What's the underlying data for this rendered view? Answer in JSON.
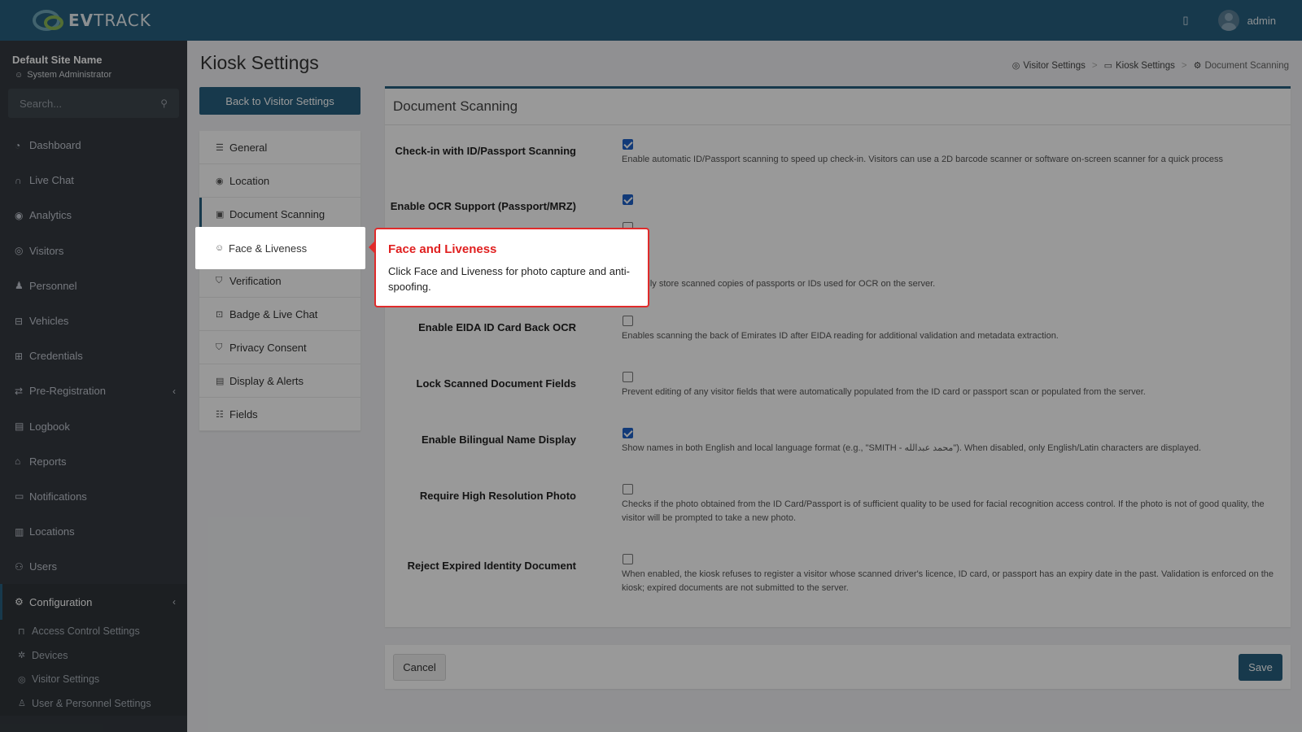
{
  "topbar": {
    "brand": "EVTRACK",
    "brand_bold": "EV",
    "brand_rest": "TRACK",
    "user": "admin"
  },
  "sidebar": {
    "site_name": "Default Site Name",
    "role": "System Administrator",
    "search_placeholder": "Search...",
    "items": [
      {
        "label": "Dashboard",
        "icon": "dashboard-icon"
      },
      {
        "label": "Live Chat",
        "icon": "headset-icon"
      },
      {
        "label": "Analytics",
        "icon": "analytics-icon"
      },
      {
        "label": "Visitors",
        "icon": "eye-icon"
      },
      {
        "label": "Personnel",
        "icon": "personnel-icon"
      },
      {
        "label": "Vehicles",
        "icon": "car-icon"
      },
      {
        "label": "Credentials",
        "icon": "credentials-icon"
      },
      {
        "label": "Pre-Registration",
        "icon": "pre-registration-icon"
      },
      {
        "label": "Logbook",
        "icon": "logbook-icon"
      },
      {
        "label": "Reports",
        "icon": "reports-icon"
      },
      {
        "label": "Notifications",
        "icon": "notifications-icon"
      },
      {
        "label": "Locations",
        "icon": "map-icon"
      },
      {
        "label": "Users",
        "icon": "users-icon"
      },
      {
        "label": "Configuration",
        "icon": "gear-icon"
      }
    ],
    "sub_items": [
      {
        "label": "Access Control Settings",
        "icon": "lock-icon"
      },
      {
        "label": "Devices",
        "icon": "devices-icon"
      },
      {
        "label": "Visitor Settings",
        "icon": "eye-icon"
      },
      {
        "label": "User & Personnel Settings",
        "icon": "user-settings-icon"
      }
    ]
  },
  "page": {
    "title": "Kiosk Settings",
    "breadcrumb": [
      "Visitor Settings",
      "Kiosk Settings",
      "Document Scanning"
    ],
    "back_button": "Back to Visitor Settings"
  },
  "settings_menu": [
    {
      "label": "General",
      "icon": "sliders-icon"
    },
    {
      "label": "Location",
      "icon": "pin-icon"
    },
    {
      "label": "Document Scanning",
      "icon": "scan-icon"
    },
    {
      "label": "Face & Liveness",
      "icon": "face-icon"
    },
    {
      "label": "Verification",
      "icon": "shield-check-icon"
    },
    {
      "label": "Badge & Live Chat",
      "icon": "badge-icon"
    },
    {
      "label": "Privacy Consent",
      "icon": "privacy-shield-icon"
    },
    {
      "label": "Display & Alerts",
      "icon": "display-icon"
    },
    {
      "label": "Fields",
      "icon": "checklist-icon"
    }
  ],
  "card": {
    "title": "Document Scanning",
    "rows": [
      {
        "label": "Check-in with ID/Passport Scanning",
        "checked": true,
        "desc": "Enable automatic ID/Passport scanning to speed up check-in. Visitors can use a 2D barcode scanner or software on-screen scanner for a quick process"
      },
      {
        "label": "Enable OCR Support (Passport/MRZ)",
        "checked": true,
        "desc": ""
      },
      {
        "label": "",
        "checked": false,
        "desc": "...atically store scanned copies of passports or IDs used for OCR on the server."
      },
      {
        "label": "Enable EIDA ID Card Back OCR",
        "checked": false,
        "desc": "Enables scanning the back of Emirates ID after EIDA reading for additional validation and metadata extraction."
      },
      {
        "label": "Lock Scanned Document Fields",
        "checked": false,
        "desc": "Prevent editing of any visitor fields that were automatically populated from the ID card or passport scan or populated from the server."
      },
      {
        "label": "Enable Bilingual Name Display",
        "checked": true,
        "desc": "Show names in both English and local language format (e.g., \"SMITH - محمد عبدالله\"). When disabled, only English/Latin characters are displayed."
      },
      {
        "label": "Require High Resolution Photo",
        "checked": false,
        "desc": "Checks if the photo obtained from the ID Card/Passport is of sufficient quality to be used for facial recognition access control. If the photo is not of good quality, the visitor will be prompted to take a new photo."
      },
      {
        "label": "Reject Expired Identity Document",
        "checked": false,
        "desc": "When enabled, the kiosk refuses to register a visitor whose scanned driver's licence, ID card, or passport has an expiry date in the past. Validation is enforced on the kiosk; expired documents are not submitted to the server."
      }
    ]
  },
  "footer": {
    "cancel": "Cancel",
    "save": "Save"
  },
  "tooltip": {
    "title": "Face and Liveness",
    "text": "Click Face and Liveness for photo capture and anti-spoofing."
  }
}
